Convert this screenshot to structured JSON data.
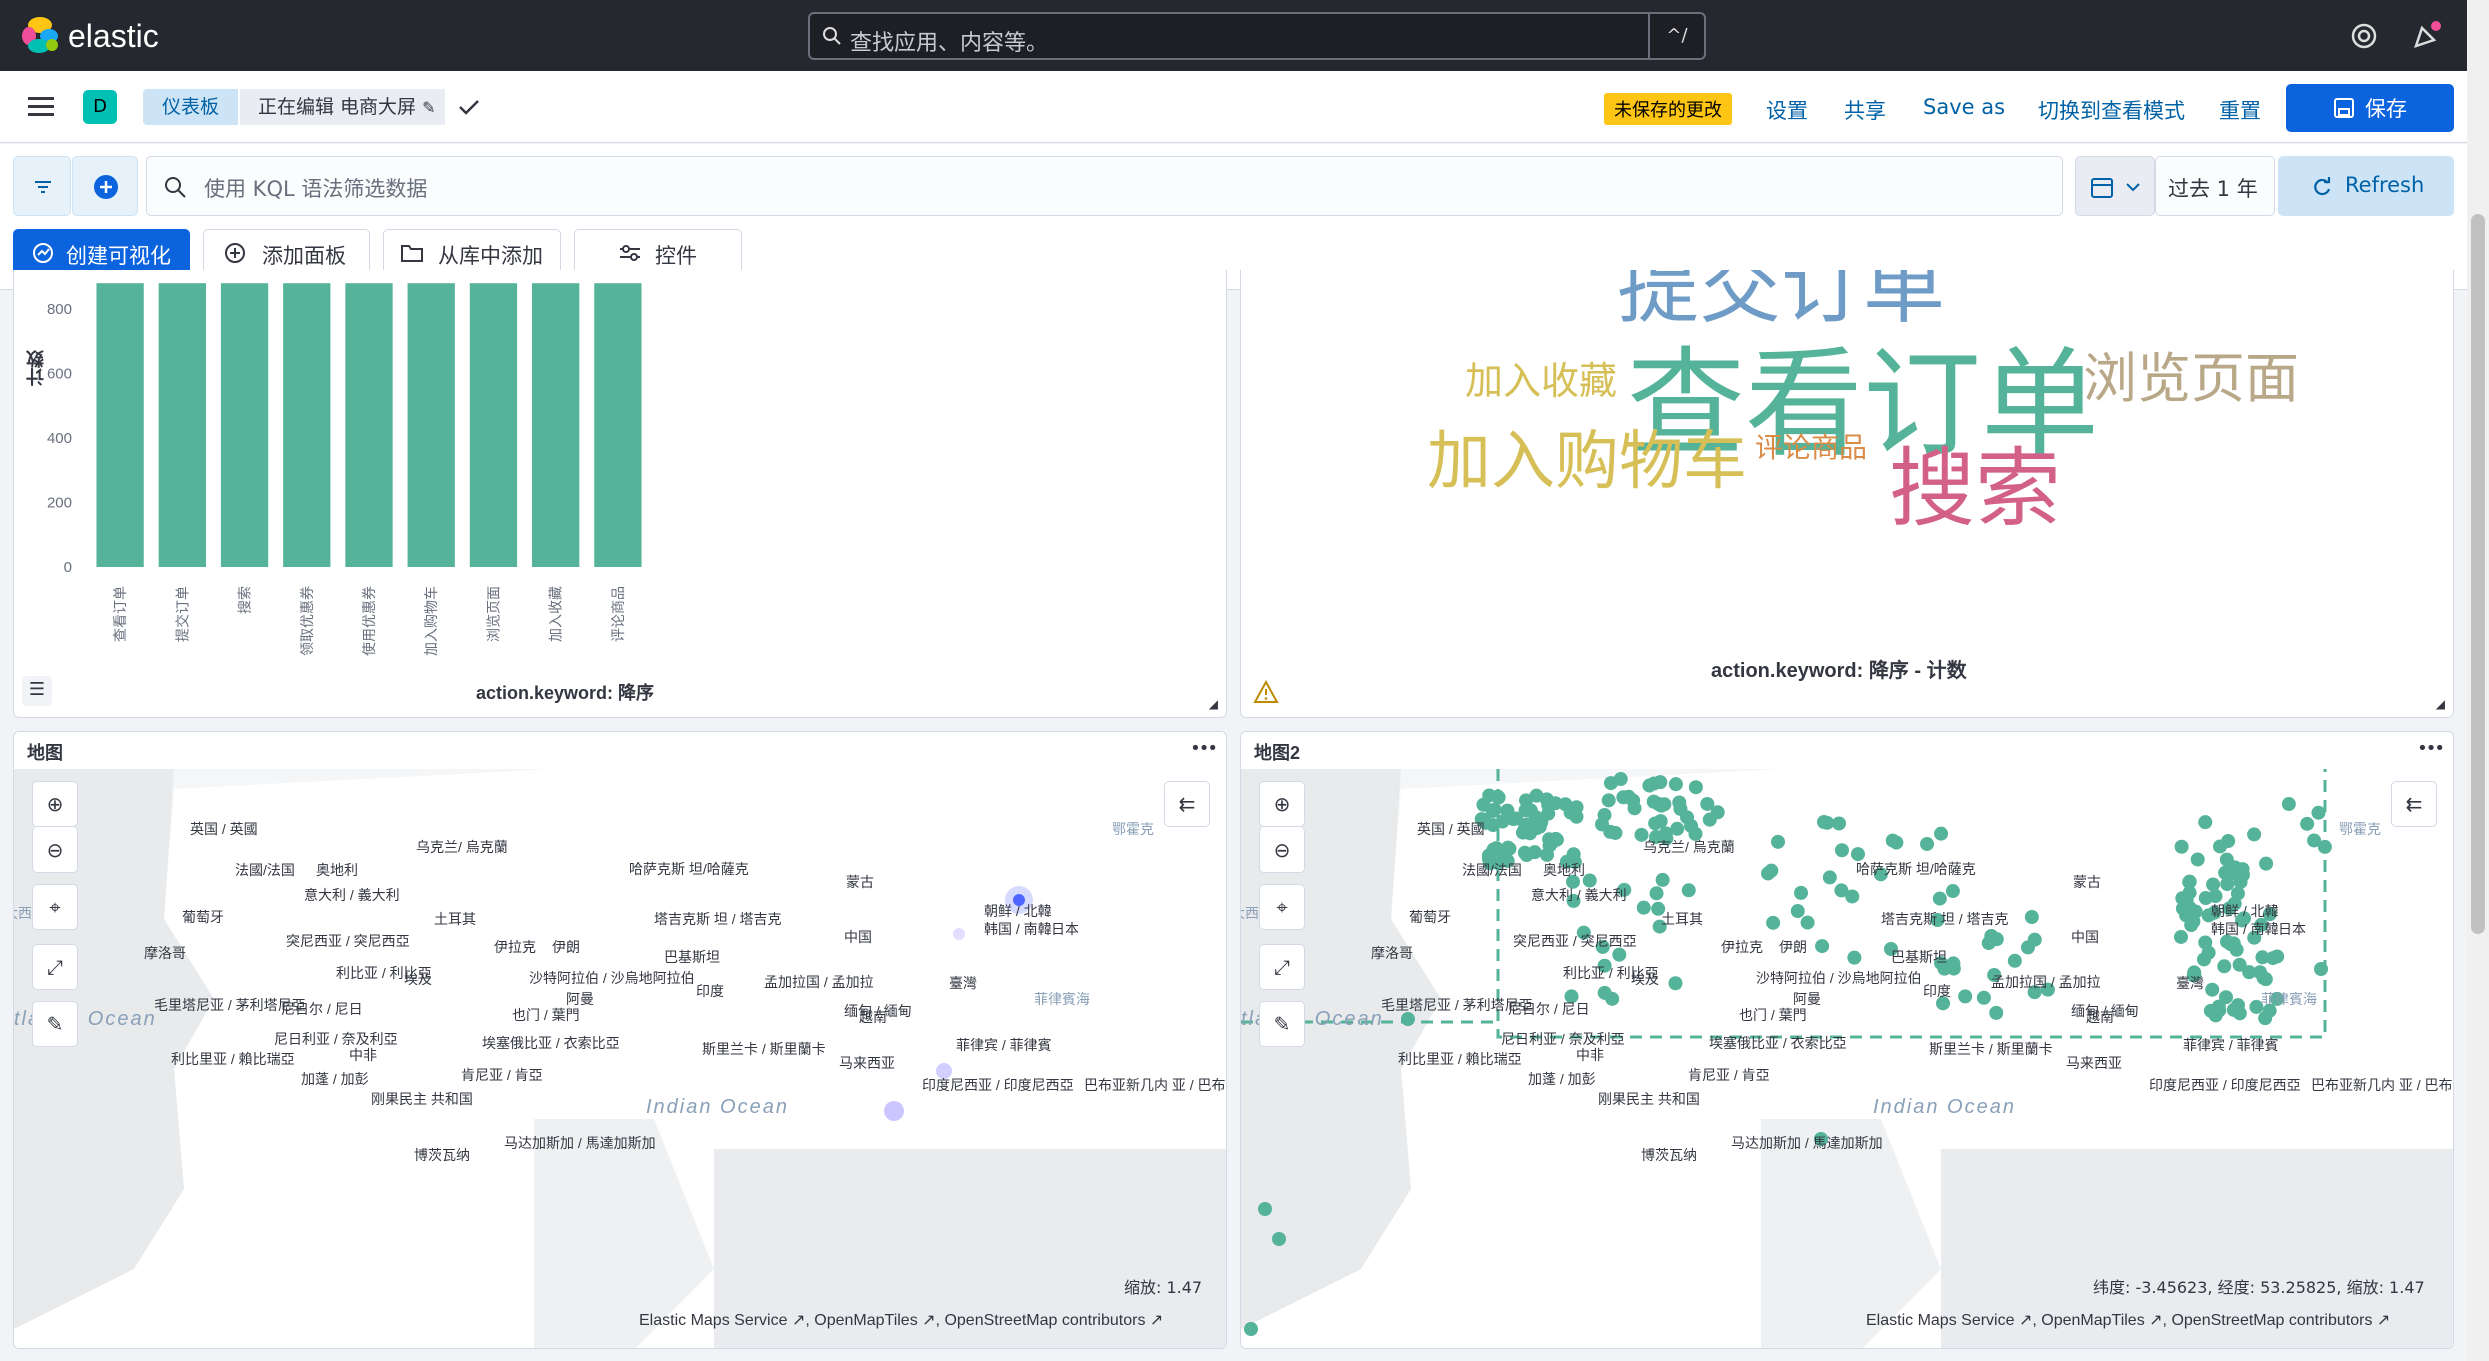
{
  "header": {
    "logo_text": "elastic",
    "search_placeholder": "查找应用、内容等。",
    "search_shortcut": "^/"
  },
  "toolbar": {
    "space_letter": "D",
    "breadcrumb_root": "仪表板",
    "breadcrumb_current": "正在编辑 电商大屏",
    "unsaved_badge": "未保存的更改",
    "settings": "设置",
    "share": "共享",
    "save_as": "Save as",
    "switch_view": "切换到查看模式",
    "reset": "重置",
    "save": "保存"
  },
  "query": {
    "kql_placeholder": "使用 KQL 语法筛选数据",
    "time_range": "过去 1 年",
    "refresh": "Refresh",
    "create_viz": "创建可视化",
    "add_panel": "添加面板",
    "add_from_library": "从库中添加",
    "controls": "控件"
  },
  "bar_panel": {
    "y_label": "计数",
    "x_label": "action.keyword: 降序"
  },
  "chart_data": {
    "type": "bar",
    "categories": [
      "查看订单",
      "提交订单",
      "搜索",
      "领取优惠券",
      "使用优惠券",
      "加入购物车",
      "浏览页面",
      "加入收藏",
      "评论商品"
    ],
    "values": [
      880,
      880,
      880,
      880,
      880,
      880,
      880,
      880,
      880
    ],
    "ylabel": "计数",
    "xlabel": "action.keyword: 降序",
    "ylim": [
      0,
      860
    ],
    "yticks": [
      0,
      200,
      400,
      600,
      800
    ],
    "color": "#54b399"
  },
  "wordcloud": {
    "words": [
      {
        "text": "查看订单",
        "color": "#54b399"
      },
      {
        "text": "加入收藏",
        "color": "#d6bf57"
      },
      {
        "text": "浏览页面",
        "color": "#b9a888"
      },
      {
        "text": "加入购物车",
        "color": "#d6bf57"
      },
      {
        "text": "评论商品",
        "color": "#da8b45"
      },
      {
        "text": "搜索",
        "color": "#d36086"
      }
    ],
    "caption": "action.keyword: 降序 - 计数"
  },
  "map1": {
    "title": "地图",
    "scale": "缩放:  1.47",
    "attribution": [
      "Elastic Maps Service",
      "OpenMapTiles",
      "OpenStreetMap contributors"
    ]
  },
  "map2": {
    "title": "地图2",
    "coords": "纬度: -3.45623, 经度: 53.25825, 缩放: 1.47",
    "attribution": [
      "Elastic Maps Service",
      "OpenMapTiles",
      "OpenStreetMap contributors"
    ]
  },
  "map_labels": [
    "英国 / 英國",
    "乌克兰/ 烏克蘭",
    "法國/法国",
    "奥地利",
    "哈萨克斯 坦/哈薩克",
    "蒙古",
    "意大利 / 義大利",
    "朝鲜 / 北韓",
    "葡萄牙",
    "土耳其",
    "塔吉克斯 坦 / 塔吉克",
    "韩国 / 南韓",
    "日本",
    "突尼西亚 / 突尼西亞",
    "伊拉克",
    "伊朗",
    "中国",
    "摩洛哥",
    "巴基斯坦",
    "利比亚 / 利比亞",
    "埃及",
    "沙特阿拉伯 / 沙烏地阿拉伯",
    "孟加拉国 / 孟加拉",
    "臺灣",
    "毛里塔尼亚 / 茅利塔尼亞",
    "阿曼",
    "印度",
    "菲律賓海",
    "尼日尔 / 尼日",
    "也门 / 葉門",
    "缅甸 / 緬甸",
    "越南",
    "尼日利亚 / 奈及利亞",
    "埃塞俄比亚 / 衣索比亞",
    "菲律宾 / 菲律賓",
    "利比里亚 / 賴比瑞亞",
    "中非",
    "斯里兰卡 / 斯里蘭卡",
    "马来西亚",
    "加蓬 / 加彭",
    "肯尼亚 / 肯亞",
    "印度尼西亚 / 印度尼西亞",
    "刚果民主 共和国",
    "巴布亚新几内 亚 / 巴布亞紐 幾內亞 / 巴布 亞新幾內亞",
    "Indian Ocean",
    "tlantic Ocean",
    "马达加斯加 / 馬達加斯加",
    "博茨瓦纳",
    "大西洋",
    "鄂霍克"
  ]
}
